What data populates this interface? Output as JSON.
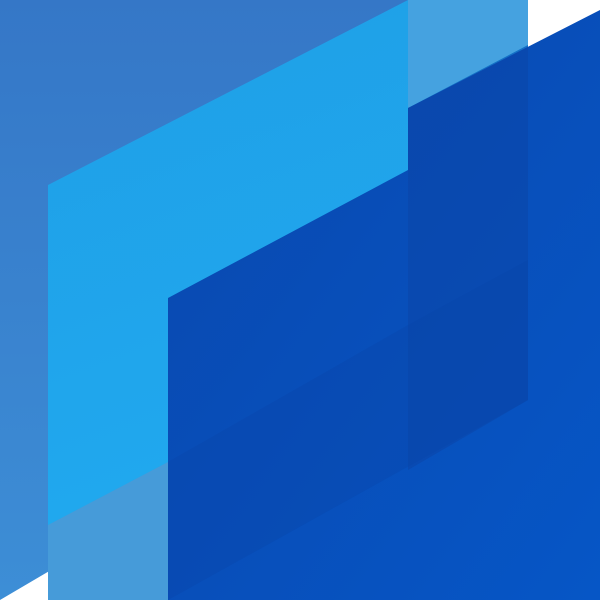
{
  "graphic": {
    "icon_name": "stacked-parallelogram-logo-icon",
    "background_color": "#ffffff",
    "colors": {
      "back_layer": "#3578c8",
      "middle_layer": "#1ea3ea",
      "middle_layer_light": "#45a2e0",
      "front_layer": "#0a4eb7",
      "front_layer_dark": "#0b45a8",
      "front_layer_light": "#0d5ac5"
    }
  }
}
